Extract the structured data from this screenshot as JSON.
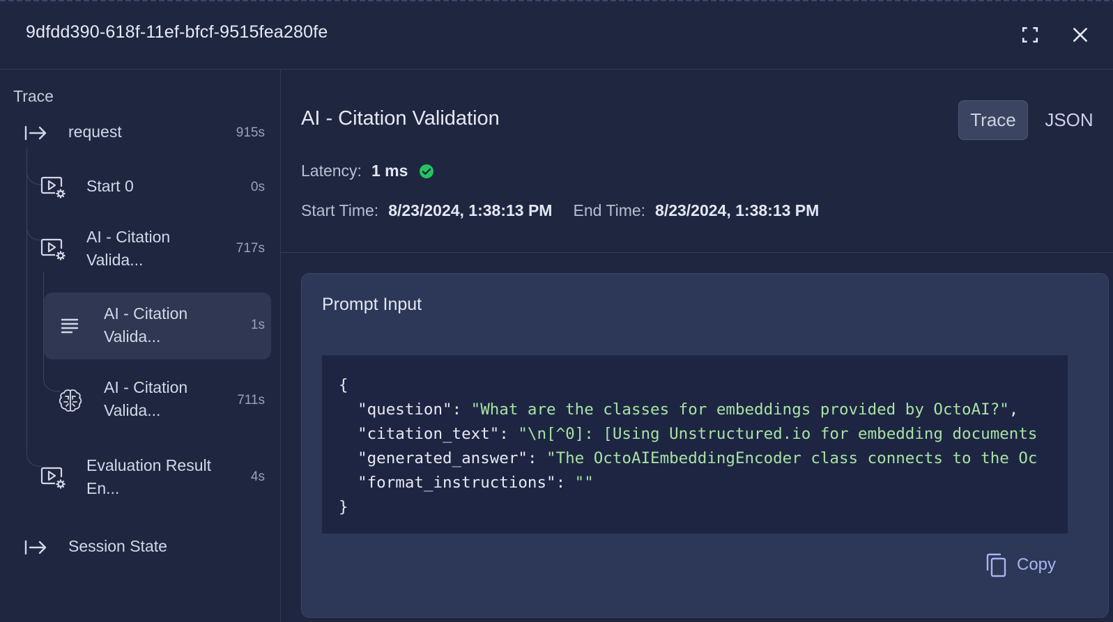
{
  "header": {
    "title": "9dfdd390-618f-11ef-bfcf-9515fea280fe",
    "expand_icon": "expand-icon",
    "close_icon": "close-icon"
  },
  "sidebar": {
    "label": "Trace",
    "nodes": [
      {
        "name": "request",
        "duration": "915s",
        "icon": "arrow-right-to-line-icon"
      },
      {
        "name": "Start 0",
        "duration": "0s",
        "icon": "video-settings-icon"
      },
      {
        "name": "AI - Citation Valida...",
        "duration": "717s",
        "icon": "video-settings-icon"
      },
      {
        "name": "AI - Citation Valida...",
        "duration": "1s",
        "icon": "text-lines-icon",
        "selected": true
      },
      {
        "name": "AI - Citation Valida...",
        "duration": "711s",
        "icon": "brain-icon"
      },
      {
        "name": "Evaluation Result En...",
        "duration": "4s",
        "icon": "video-settings-icon"
      },
      {
        "name": "Session State",
        "duration": "",
        "icon": "arrow-right-to-line-icon"
      }
    ]
  },
  "main": {
    "heading": "AI - Citation Validation",
    "tabs": [
      {
        "label": "Trace",
        "active": true
      },
      {
        "label": "JSON",
        "active": false
      }
    ],
    "latency_label": "Latency:",
    "latency_value": "1 ms",
    "start_label": "Start Time:",
    "start_value": "8/23/2024, 1:38:13 PM",
    "end_label": "End Time:",
    "end_value": "8/23/2024, 1:38:13 PM",
    "card": {
      "title": "Prompt Input",
      "code": {
        "open": "{",
        "close": "}",
        "lines": [
          {
            "key": "\"question\"",
            "value": "\"What are the classes for embeddings provided by OctoAI?\"",
            "trail": ","
          },
          {
            "key": "\"citation_text\"",
            "value": "\"\\n[^0]: [Using Unstructured.io for embedding documents",
            "trail": ""
          },
          {
            "key": "\"generated_answer\"",
            "value": "\"The OctoAIEmbeddingEncoder class connects to the Oc",
            "trail": ""
          },
          {
            "key": "\"format_instructions\"",
            "value": "\"\"",
            "trail": ""
          }
        ]
      },
      "copy_label": "Copy"
    }
  },
  "colors": {
    "background": "#1f2640",
    "card": "#2d3757",
    "code_bg": "#1e2543",
    "string": "#a6e3a1",
    "accent": "#a9b4f0",
    "success": "#22c55e"
  }
}
